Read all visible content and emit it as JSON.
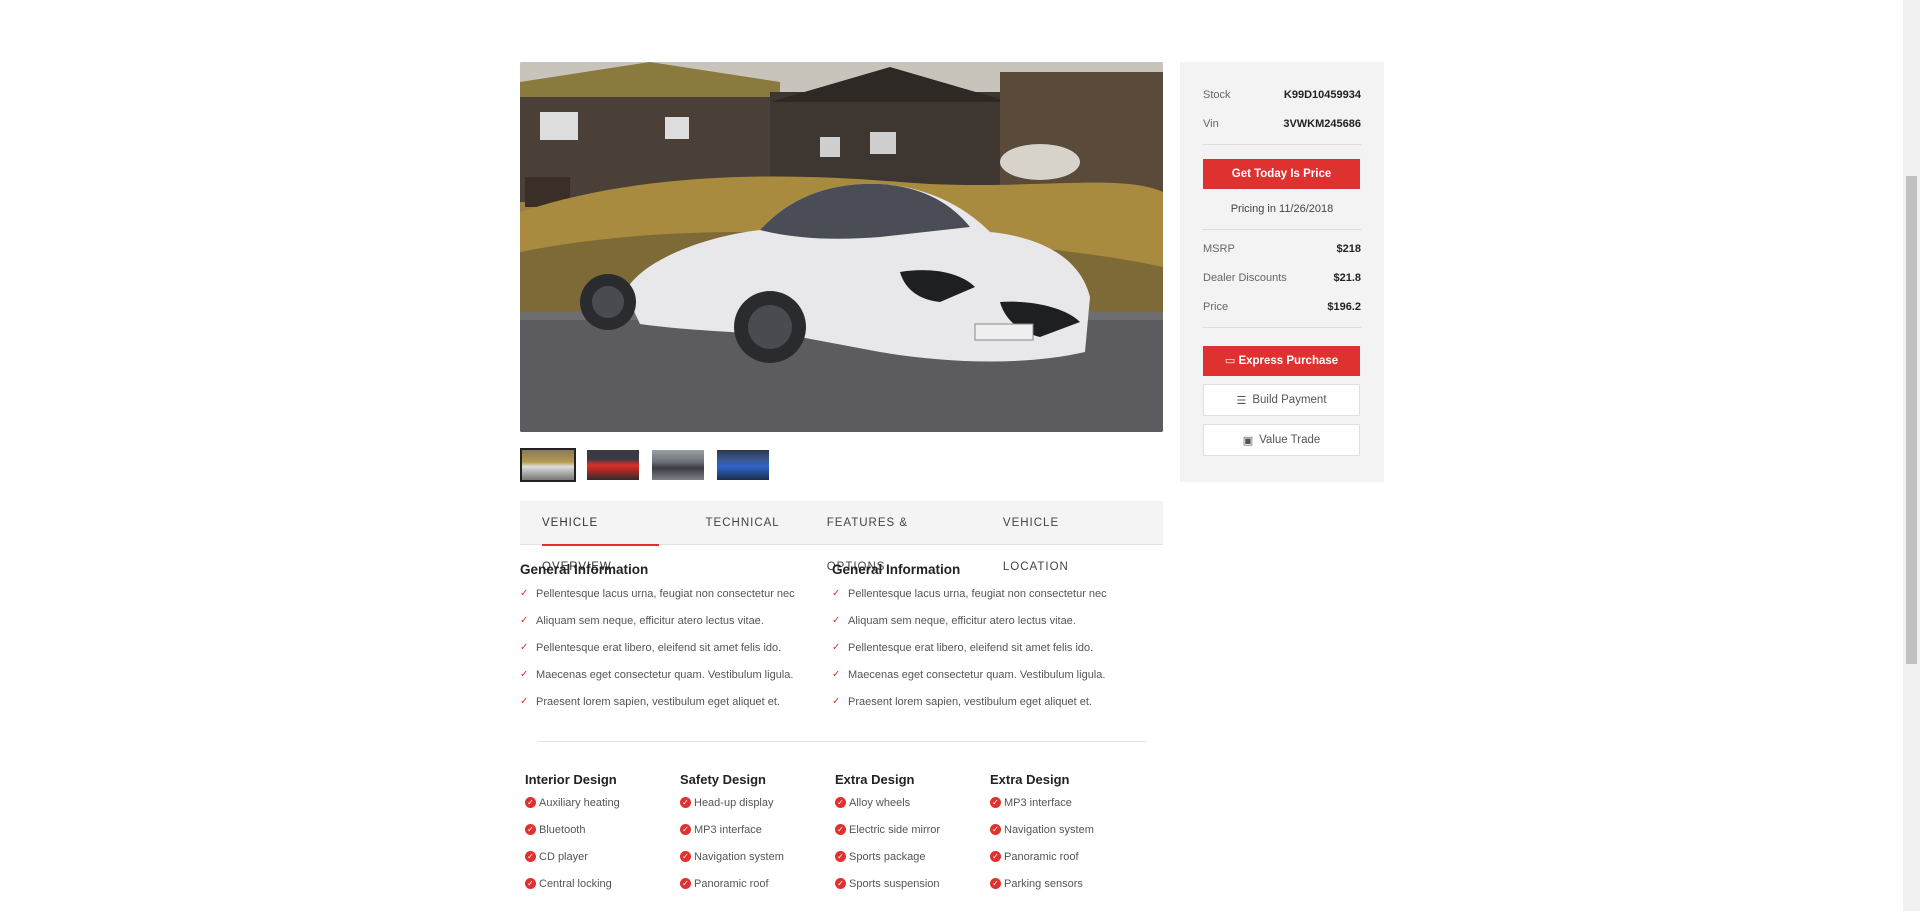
{
  "gallery": {
    "thumbnails": [
      {
        "name": "thumb-silver-supercar",
        "active": true
      },
      {
        "name": "thumb-red-car",
        "active": false
      },
      {
        "name": "thumb-gray-car",
        "active": false
      },
      {
        "name": "thumb-blue-car",
        "active": false
      }
    ]
  },
  "tabs": [
    "VEHICLE OVERVIEW",
    "TECHNICAL",
    "FEATURES & OPTIONS",
    "VEHICLE LOCATION"
  ],
  "general_info": [
    {
      "title": "General Information",
      "items": [
        "Pellentesque lacus urna, feugiat non consectetur nec",
        "Aliquam sem neque, efficitur atero lectus vitae.",
        "Pellentesque erat libero, eleifend sit amet felis ido.",
        "Maecenas eget consectetur quam. Vestibulum ligula.",
        "Praesent lorem sapien, vestibulum eget aliquet et."
      ]
    },
    {
      "title": "General Information",
      "items": [
        "Pellentesque lacus urna, feugiat non consectetur nec",
        "Aliquam sem neque, efficitur atero lectus vitae.",
        "Pellentesque erat libero, eleifend sit amet felis ido.",
        "Maecenas eget consectetur quam. Vestibulum ligula.",
        "Praesent lorem sapien, vestibulum eget aliquet et."
      ]
    }
  ],
  "designs": [
    {
      "title": "Interior Design",
      "items": [
        "Auxiliary heating",
        "Bluetooth",
        "CD player",
        "Central locking"
      ]
    },
    {
      "title": "Safety Design",
      "items": [
        "Head-up display",
        "MP3 interface",
        "Navigation system",
        "Panoramic roof"
      ]
    },
    {
      "title": "Extra Design",
      "items": [
        "Alloy wheels",
        "Electric side mirror",
        "Sports package",
        "Sports suspension"
      ]
    },
    {
      "title": "Extra Design",
      "items": [
        "MP3 interface",
        "Navigation system",
        "Panoramic roof",
        "Parking sensors"
      ]
    }
  ],
  "sidebar": {
    "stock_label": "Stock",
    "stock_value": "K99D10459934",
    "vin_label": "Vin",
    "vin_value": "3VWKM245686",
    "get_price_button": "Get Today Is Price",
    "pricing_note": "Pricing in 11/26/2018",
    "msrp_label": "MSRP",
    "msrp_value": "$218",
    "discount_label": "Dealer Discounts",
    "discount_value": "$21.8",
    "price_label": "Price",
    "price_value": "$196.2",
    "express_purchase": "Express Purchase",
    "build_payment": "Build Payment",
    "value_trade": "Value Trade"
  },
  "colors": {
    "accent": "#e03131",
    "sidebar_bg": "#f3f3f3",
    "tabs_bg": "#f4f4f4"
  },
  "icons": {
    "check": "check-icon",
    "credit_card": "credit-card-icon",
    "sliders": "sliders-icon",
    "money": "money-icon"
  }
}
